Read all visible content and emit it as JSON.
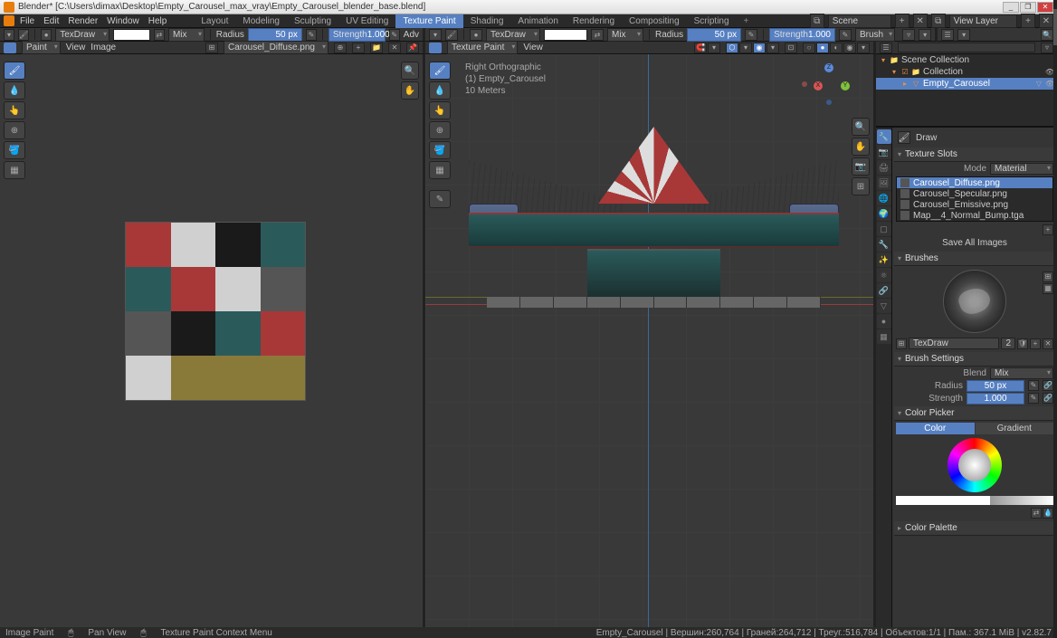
{
  "titlebar": {
    "title": "Blender* [C:\\Users\\dimax\\Desktop\\Empty_Carousel_max_vray\\Empty_Carousel_blender_base.blend]"
  },
  "menubar": {
    "items": [
      "File",
      "Edit",
      "Render",
      "Window",
      "Help"
    ],
    "tabs": [
      "Layout",
      "Modeling",
      "Sculpting",
      "UV Editing",
      "Texture Paint",
      "Shading",
      "Animation",
      "Rendering",
      "Compositing",
      "Scripting"
    ],
    "active_tab": "Texture Paint",
    "scene_label": "Scene",
    "viewlayer_label": "View Layer"
  },
  "toolheader_left": {
    "brush": "TexDraw",
    "blend": "Mix",
    "radius_label": "Radius",
    "radius_value": "50 px",
    "strength_label": "Strength",
    "strength_value": "1.000",
    "adv": "Adv"
  },
  "toolheader_right": {
    "brush": "TexDraw",
    "blend": "Mix",
    "radius_label": "Radius",
    "radius_value": "50 px",
    "strength_label": "Strength",
    "strength_value": "1.000",
    "brush_menu": "Brush"
  },
  "subheader_left": {
    "mode": "Paint",
    "menus": [
      "View",
      "Image"
    ],
    "image_name": "Carousel_Diffuse.png"
  },
  "subheader_right": {
    "mode": "Texture Paint",
    "menus": [
      "View"
    ]
  },
  "overlay": {
    "line1": "Right Orthographic",
    "line2": "(1) Empty_Carousel",
    "line3": "10 Meters"
  },
  "outliner": {
    "search_placeholder": "",
    "items": [
      {
        "name": "Scene Collection",
        "indent": 0,
        "selected": false,
        "expandable": true
      },
      {
        "name": "Collection",
        "indent": 1,
        "selected": false,
        "expandable": true
      },
      {
        "name": "Empty_Carousel",
        "indent": 2,
        "selected": true,
        "expandable": true
      }
    ]
  },
  "properties": {
    "draw": "Draw",
    "texture_slots": {
      "header": "Texture Slots",
      "mode_label": "Mode",
      "mode_value": "Material",
      "items": [
        {
          "name": "Carousel_Diffuse.png",
          "selected": true
        },
        {
          "name": "Carousel_Specular.png",
          "selected": false
        },
        {
          "name": "Carousel_Emissive.png",
          "selected": false
        },
        {
          "name": "Map__4_Normal_Bump.tga",
          "selected": false
        }
      ],
      "save_all": "Save All Images"
    },
    "brushes": {
      "header": "Brushes",
      "name": "TexDraw",
      "users": "2"
    },
    "brush_settings": {
      "header": "Brush Settings",
      "blend_label": "Blend",
      "blend_value": "Mix",
      "radius_label": "Radius",
      "radius_value": "50 px",
      "strength_label": "Strength",
      "strength_value": "1.000"
    },
    "color_picker": {
      "header": "Color Picker",
      "color_btn": "Color",
      "gradient_btn": "Gradient"
    },
    "color_palette": {
      "header": "Color Palette"
    }
  },
  "statusbar": {
    "left1": "Image Paint",
    "left2": "Pan View",
    "left3": "Texture Paint Context Menu",
    "right": "Empty_Carousel | Вершин:260,764 | Граней:264,712 | Треуг.:516,784 | Объектов:1/1 | Пам.: 367.1 MiB | v2.82.7"
  }
}
